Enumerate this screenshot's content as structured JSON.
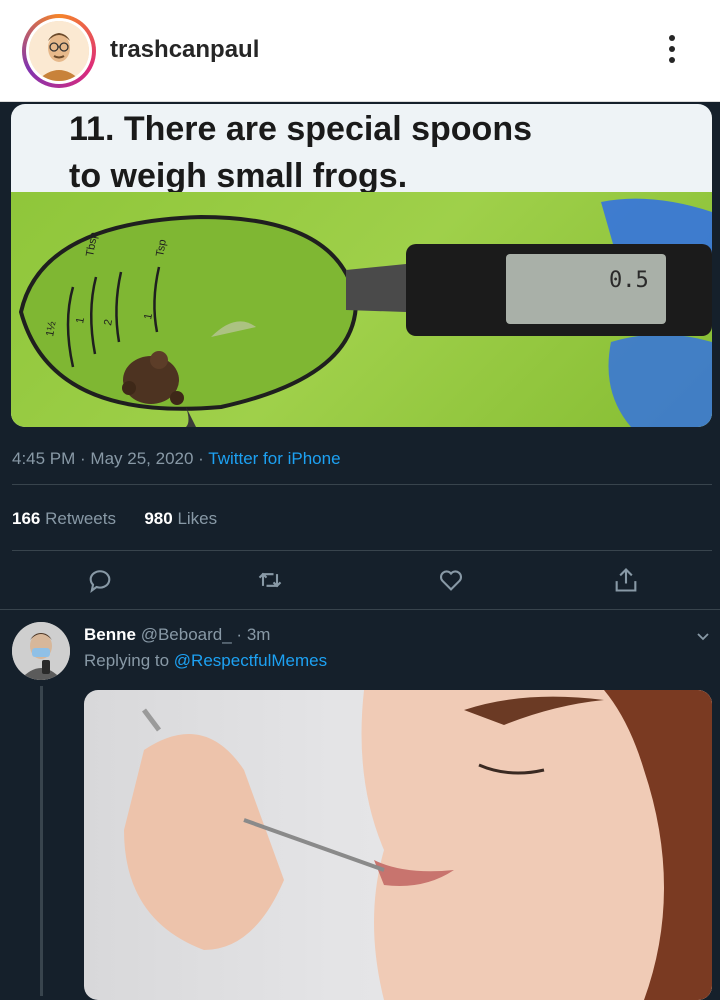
{
  "header": {
    "username": "trashcanpaul",
    "avatar_icon": "cartoon-portrait-avatar",
    "menu_icon": "more-vertical-icon"
  },
  "tweet": {
    "image_caption_line1": "11. There are special spoons",
    "image_caption_line2": "to weigh small frogs.",
    "scale_reading": "0.5",
    "spoon_labels": [
      "Tbsp",
      "Tsp",
      "1½",
      "1",
      "2",
      "1"
    ],
    "time": "4:45 PM",
    "date": "May 25, 2020",
    "source": "Twitter for iPhone",
    "retweets_count": "166",
    "retweets_label": "Retweets",
    "likes_count": "980",
    "likes_label": "Likes"
  },
  "actions": {
    "reply_icon": "reply-icon",
    "retweet_icon": "retweet-icon",
    "like_icon": "heart-icon",
    "share_icon": "share-icon"
  },
  "reply": {
    "name": "Benne",
    "handle": "@Beboard_",
    "time": "3m",
    "replying_label": "Replying to",
    "replying_to": "@RespectfulMemes"
  },
  "colors": {
    "background": "#15202b",
    "accent": "#1da1f2",
    "secondary_text": "#8899a6"
  }
}
